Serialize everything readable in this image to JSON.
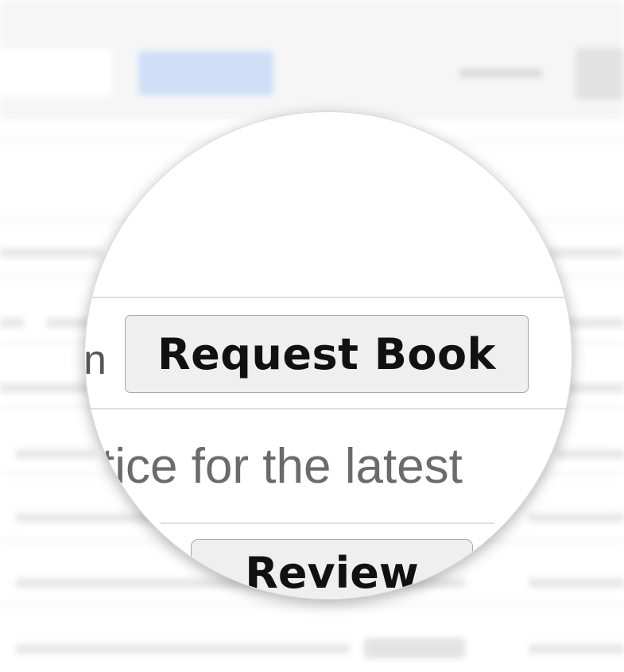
{
  "lens": {
    "left_fragment": "n",
    "request_button_label": "Request Book",
    "notice_fragment": "tice for the latest",
    "review_button_label": "Review"
  }
}
